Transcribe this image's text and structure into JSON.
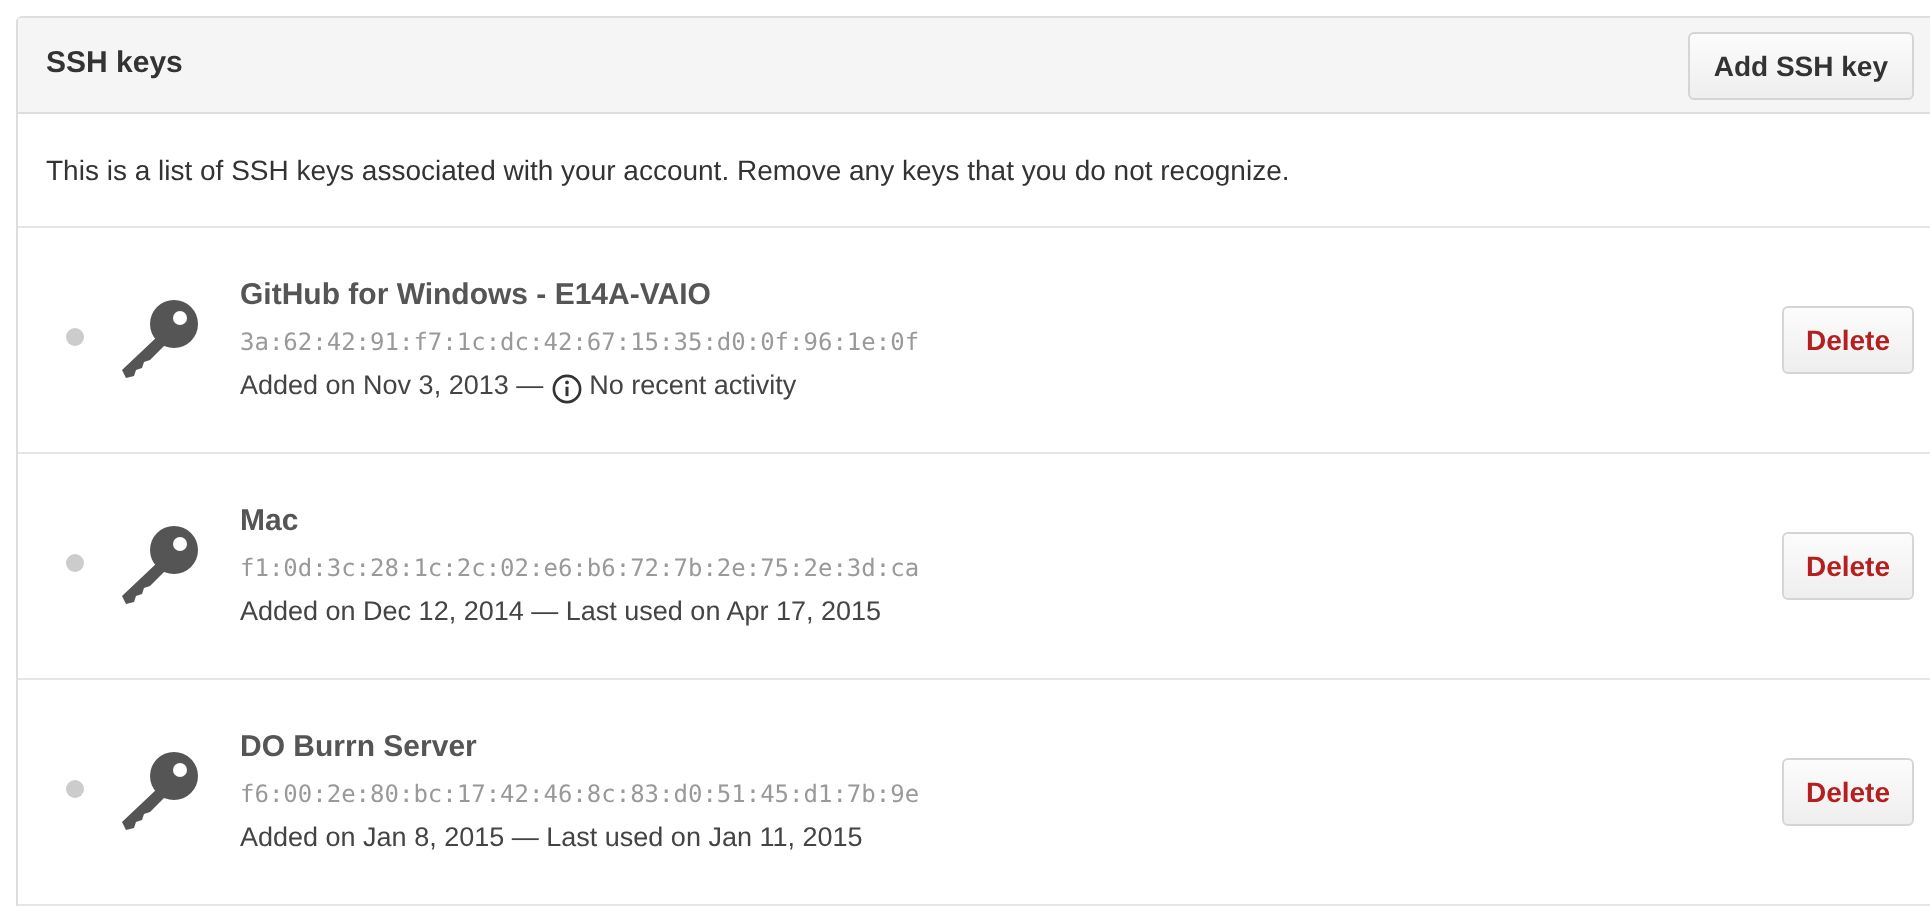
{
  "panel": {
    "title": "SSH keys",
    "add_button": "Add SSH key"
  },
  "description": "This is a list of SSH keys associated with your account. Remove any keys that you do not recognize.",
  "keys": [
    {
      "name": "GitHub for Windows - E14A-VAIO",
      "fingerprint": "3a:62:42:91:f7:1c:dc:42:67:15:35:d0:0f:96:1e:0f",
      "added": "Added on Nov 3, 2013 —",
      "kind": "unused",
      "activity": "No recent activity",
      "delete": "Delete"
    },
    {
      "name": "Mac",
      "fingerprint": "f1:0d:3c:28:1c:2c:02:e6:b6:72:7b:2e:75:2e:3d:ca",
      "added": "Added on Dec 12, 2014 —",
      "kind": "used",
      "activity": "Last used on Apr 17, 2015",
      "delete": "Delete"
    },
    {
      "name": "DO Burrn Server",
      "fingerprint": "f6:00:2e:80:bc:17:42:46:8c:83:d0:51:45:d1:7b:9e",
      "added": "Added on Jan 8, 2015 —",
      "kind": "used",
      "activity": "Last used on Jan 11, 2015",
      "delete": "Delete"
    }
  ]
}
